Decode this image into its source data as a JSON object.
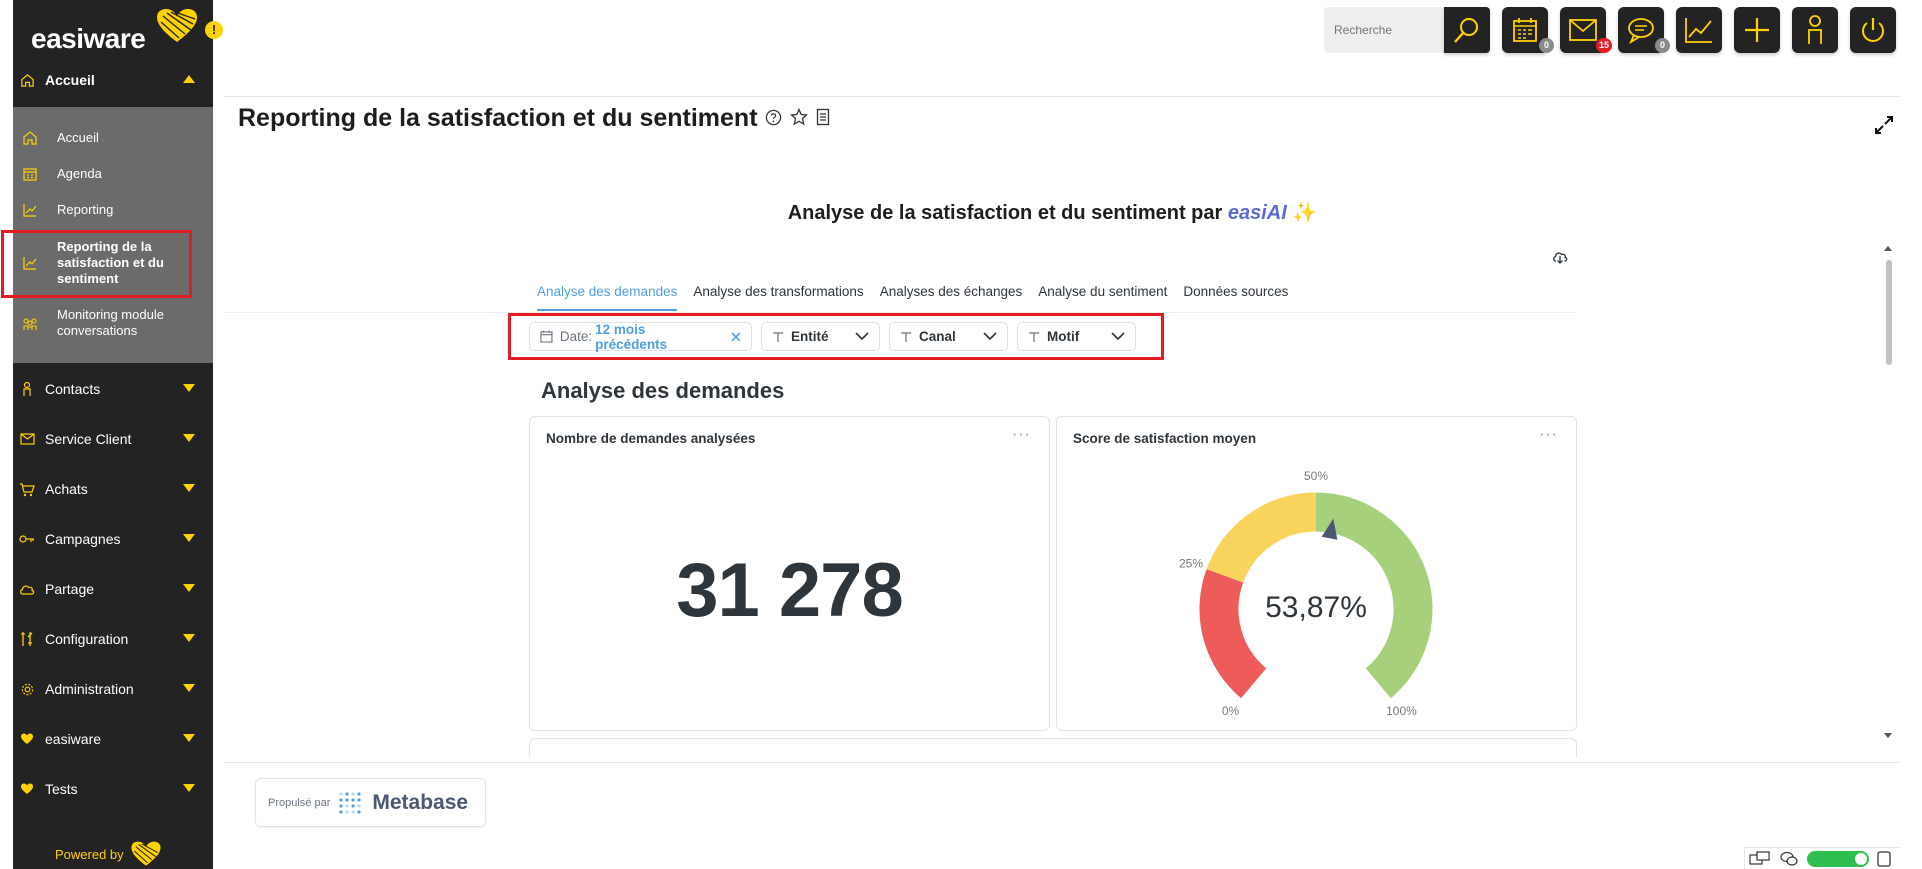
{
  "sidebar": {
    "logo_text": "easiware",
    "notification_mark": "!",
    "accueil_section": "Accueil",
    "sub_items": [
      {
        "label": "Accueil",
        "icon": "home-icon"
      },
      {
        "label": "Agenda",
        "icon": "calendar-icon"
      },
      {
        "label": "Reporting",
        "icon": "chart-line-icon"
      },
      {
        "label": "Reporting de la satisfaction et du sentiment",
        "icon": "chart-line-icon"
      },
      {
        "label": "Monitoring module conversations",
        "icon": "people-icon"
      }
    ],
    "sections": [
      {
        "label": "Contacts",
        "icon": "person-icon"
      },
      {
        "label": "Service Client",
        "icon": "envelope-icon"
      },
      {
        "label": "Achats",
        "icon": "cart-icon"
      },
      {
        "label": "Campagnes",
        "icon": "key-icon"
      },
      {
        "label": "Partage",
        "icon": "cloud-icon"
      },
      {
        "label": "Configuration",
        "icon": "tools-icon"
      },
      {
        "label": "Administration",
        "icon": "gear-icon"
      },
      {
        "label": "easiware",
        "icon": "heart-icon"
      },
      {
        "label": "Tests",
        "icon": "heart-icon"
      }
    ],
    "powered_by": "Powered by"
  },
  "topbar": {
    "search_placeholder": "Recherche",
    "calendar_badge": "0",
    "mail_badge": "15",
    "chat_badge": "0"
  },
  "page": {
    "title": "Reporting de la satisfaction et du sentiment"
  },
  "dashboard": {
    "heading_prefix": "Analyse de la satisfaction et du sentiment par",
    "heading_ai": "easiAI",
    "heading_sparkle": "✨",
    "tabs": [
      "Analyse des demandes",
      "Analyse des transformations",
      "Analyses des échanges",
      "Analyse du sentiment",
      "Données sources"
    ],
    "filters": {
      "date_label": "Date:",
      "date_value": "12 mois précédents",
      "entity": "Entité",
      "channel": "Canal",
      "motive": "Motif"
    },
    "section_title": "Analyse des demandes",
    "card_requests": {
      "title": "Nombre de demandes analysées",
      "value": "31 278",
      "menu": "···"
    },
    "card_satisfaction": {
      "title": "Score de satisfaction moyen",
      "value": "53,87%",
      "menu": "···",
      "gauge_value": 53.87,
      "ticks": [
        "0%",
        "25%",
        "50%",
        "100%"
      ],
      "colors": {
        "low": "#ed5b5b",
        "mid": "#f9d45c",
        "high": "#a7d07c"
      }
    }
  },
  "footer": {
    "propulse": "Propulsé par",
    "brand": "Metabase"
  },
  "colors": {
    "sidebar_bg": "#232323",
    "accent_yellow": "#ffd200",
    "metabase_blue": "#509ee3",
    "highlight_red": "#e31b23"
  }
}
